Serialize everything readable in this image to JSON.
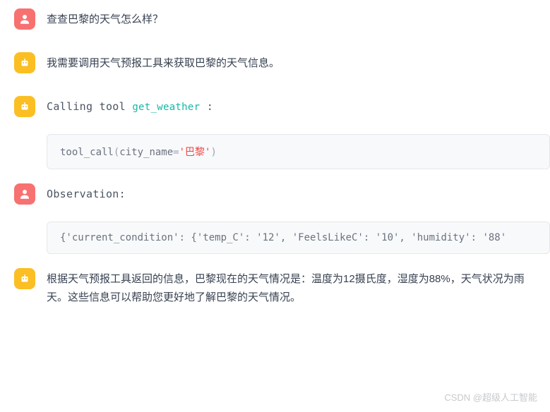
{
  "messages": [
    {
      "role": "user",
      "text": "查查巴黎的天气怎么样？"
    },
    {
      "role": "assistant",
      "text": "我需要调用天气预报工具来获取巴黎的天气信息。"
    },
    {
      "role": "assistant",
      "calling_label": "Calling tool",
      "tool_name": "get_weather",
      "colon": " :",
      "code_func": "tool_call",
      "code_open": "(",
      "code_arg": "city_name",
      "code_eq": "=",
      "code_str": "'巴黎'",
      "code_close": ")"
    },
    {
      "role": "user",
      "obs_label": "Observation:",
      "obs_code": "{'current_condition': {'temp_C': '12', 'FeelsLikeC': '10', 'humidity': '88'"
    },
    {
      "role": "assistant",
      "text": "根据天气预报工具返回的信息，巴黎现在的天气情况是：温度为12摄氏度，湿度为88%，天气状况为雨天。这些信息可以帮助您更好地了解巴黎的天气情况。"
    }
  ],
  "watermark": "CSDN @超级人工智能"
}
